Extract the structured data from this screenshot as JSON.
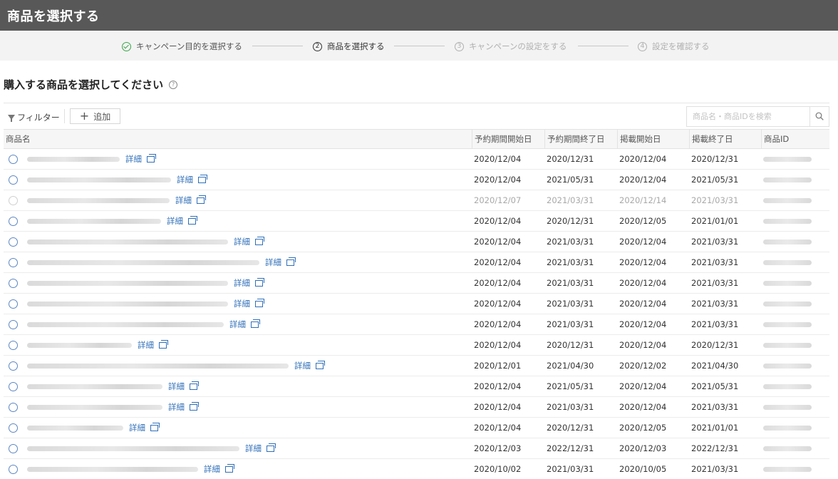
{
  "header": {
    "title": "商品を選択する"
  },
  "steps": [
    {
      "label": "キャンペーン目的を選択する",
      "state": "done"
    },
    {
      "number": "2",
      "label": "商品を選択する",
      "state": "active"
    },
    {
      "number": "3",
      "label": "キャンペーンの設定をする",
      "state": "pending"
    },
    {
      "number": "4",
      "label": "設定を確認する",
      "state": "pending"
    }
  ],
  "section": {
    "title": "購入する商品を選択してください",
    "help": "?"
  },
  "toolbar": {
    "filter_label": "フィルター",
    "add_label": "追加",
    "search_placeholder": "商品名・商品IDを検索"
  },
  "table": {
    "columns": {
      "name": "商品名",
      "reserve_start": "予約期間開始日",
      "reserve_end": "予約期間終了日",
      "publish_start": "掲載開始日",
      "publish_end": "掲載終了日",
      "product_id": "商品ID"
    },
    "detail_label": "詳細",
    "rows": [
      {
        "reserve_start": "2020/12/04",
        "reserve_end": "2020/12/31",
        "publish_start": "2020/12/04",
        "publish_end": "2020/12/31"
      },
      {
        "reserve_start": "2020/12/04",
        "reserve_end": "2021/05/31",
        "publish_start": "2020/12/04",
        "publish_end": "2021/05/31"
      },
      {
        "reserve_start": "2020/12/07",
        "reserve_end": "2021/03/31",
        "publish_start": "2020/12/14",
        "publish_end": "2021/03/31"
      },
      {
        "reserve_start": "2020/12/04",
        "reserve_end": "2020/12/31",
        "publish_start": "2020/12/05",
        "publish_end": "2021/01/01"
      },
      {
        "reserve_start": "2020/12/04",
        "reserve_end": "2021/03/31",
        "publish_start": "2020/12/04",
        "publish_end": "2021/03/31"
      },
      {
        "reserve_start": "2020/12/04",
        "reserve_end": "2021/03/31",
        "publish_start": "2020/12/04",
        "publish_end": "2021/03/31"
      },
      {
        "reserve_start": "2020/12/04",
        "reserve_end": "2021/03/31",
        "publish_start": "2020/12/04",
        "publish_end": "2021/03/31"
      },
      {
        "reserve_start": "2020/12/04",
        "reserve_end": "2021/03/31",
        "publish_start": "2020/12/04",
        "publish_end": "2021/03/31"
      },
      {
        "reserve_start": "2020/12/04",
        "reserve_end": "2021/03/31",
        "publish_start": "2020/12/04",
        "publish_end": "2021/03/31"
      },
      {
        "reserve_start": "2020/12/04",
        "reserve_end": "2020/12/31",
        "publish_start": "2020/12/04",
        "publish_end": "2020/12/31"
      },
      {
        "reserve_start": "2020/12/01",
        "reserve_end": "2021/04/30",
        "publish_start": "2020/12/02",
        "publish_end": "2021/04/30"
      },
      {
        "reserve_start": "2020/12/04",
        "reserve_end": "2021/05/31",
        "publish_start": "2020/12/04",
        "publish_end": "2021/05/31"
      },
      {
        "reserve_start": "2020/12/04",
        "reserve_end": "2021/03/31",
        "publish_start": "2020/12/04",
        "publish_end": "2021/03/31"
      },
      {
        "reserve_start": "2020/12/04",
        "reserve_end": "2020/12/31",
        "publish_start": "2020/12/05",
        "publish_end": "2021/01/01"
      },
      {
        "reserve_start": "2020/12/03",
        "reserve_end": "2022/12/31",
        "publish_start": "2020/12/03",
        "publish_end": "2022/12/31"
      },
      {
        "reserve_start": "2020/10/02",
        "reserve_end": "2021/03/31",
        "publish_start": "2020/10/05",
        "publish_end": "2021/03/31"
      }
    ]
  },
  "colors": {
    "header_bg": "#585858",
    "steps_bg": "#f3f3f3",
    "link": "#2f6fb8",
    "radio": "#5c86c4",
    "done_check": "#3aa64a"
  },
  "icons": [
    "check-circle-icon",
    "help-icon",
    "filter-icon",
    "plus-icon",
    "search-icon",
    "external-link-icon"
  ]
}
